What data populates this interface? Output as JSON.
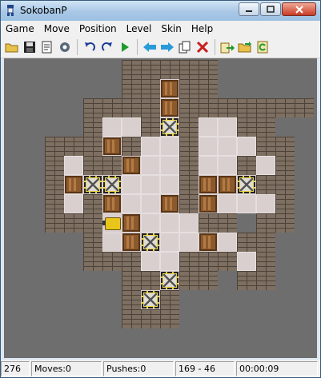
{
  "window": {
    "title": "SokobanP"
  },
  "menu": [
    {
      "label": "Game"
    },
    {
      "label": "Move"
    },
    {
      "label": "Position"
    },
    {
      "label": "Level"
    },
    {
      "label": "Skin"
    },
    {
      "label": "Help"
    }
  ],
  "toolbar": [
    {
      "icon": "open-folder-icon"
    },
    {
      "icon": "save-icon"
    },
    {
      "icon": "properties-icon"
    },
    {
      "icon": "settings-icon"
    },
    {
      "sep": true
    },
    {
      "icon": "undo-icon"
    },
    {
      "icon": "redo-icon"
    },
    {
      "icon": "play-icon"
    },
    {
      "sep": true
    },
    {
      "icon": "arrow-left-icon"
    },
    {
      "icon": "arrow-right-icon"
    },
    {
      "icon": "copy-icon"
    },
    {
      "icon": "delete-icon"
    },
    {
      "sep": true
    },
    {
      "icon": "next-level-icon"
    },
    {
      "icon": "load-level-icon"
    },
    {
      "icon": "refresh-icon"
    }
  ],
  "status": {
    "level_id": "276",
    "moves": "Moves:0",
    "pushes": "Pushes:0",
    "position": "169 - 46",
    "time": "00:00:09"
  },
  "board": {
    "legend": {
      "#": "wall",
      " ": "floor",
      ".": "goal",
      "$": "box",
      "*": "box-on-goal",
      "@": "player",
      "_": "outside"
    },
    "rows": [
      "______#####_____",
      "______##$##_____",
      "____####$#######",
      "____#  #.#  ##__",
      "__###$#  #   ##_",
      "__# ##$  #  # #_",
      "__#$..   #$$.##_",
      "__# #$  $#$   #_",
      "__###@$   ##_##_",
      "____# $.  $ ##__",
      "____###  ### #__",
      "______##.##_##__",
      "______#.#_______",
      "______###_______"
    ]
  }
}
